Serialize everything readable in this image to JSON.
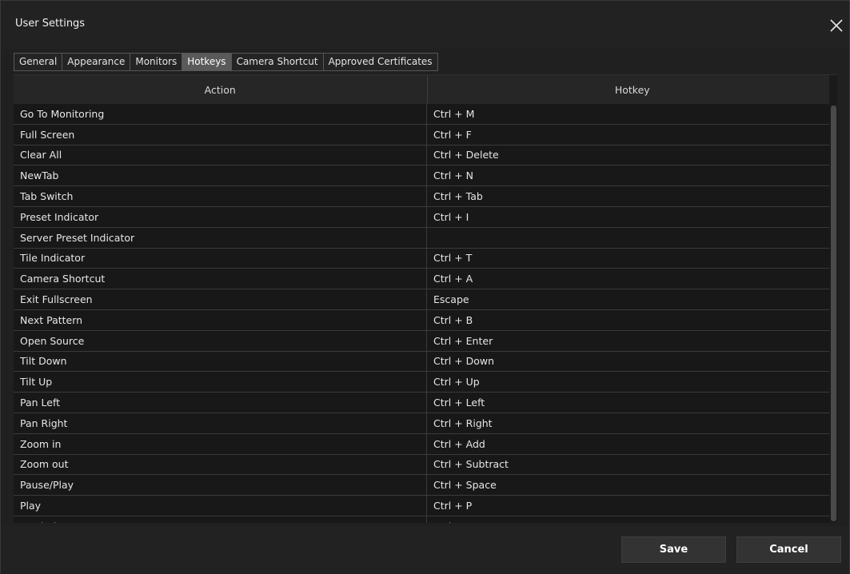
{
  "window": {
    "title": "User Settings",
    "close_icon": "close-icon"
  },
  "tabs": [
    {
      "label": "General",
      "active": false
    },
    {
      "label": "Appearance",
      "active": false
    },
    {
      "label": "Monitors",
      "active": false
    },
    {
      "label": "Hotkeys",
      "active": true
    },
    {
      "label": "Camera Shortcut",
      "active": false
    },
    {
      "label": "Approved Certificates",
      "active": false
    }
  ],
  "table": {
    "columns": [
      "Action",
      "Hotkey"
    ],
    "rows": [
      [
        "Go To Monitoring",
        "Ctrl + M"
      ],
      [
        "Full Screen",
        "Ctrl + F"
      ],
      [
        "Clear All",
        "Ctrl + Delete"
      ],
      [
        "NewTab",
        "Ctrl + N"
      ],
      [
        "Tab Switch",
        "Ctrl + Tab"
      ],
      [
        "Preset Indicator",
        "Ctrl + I"
      ],
      [
        "Server Preset Indicator",
        ""
      ],
      [
        "Tile Indicator",
        "Ctrl + T"
      ],
      [
        "Camera Shortcut",
        "Ctrl + A"
      ],
      [
        "Exit Fullscreen",
        "Escape"
      ],
      [
        "Next Pattern",
        "Ctrl + B"
      ],
      [
        "Open Source",
        "Ctrl + Enter"
      ],
      [
        "Tilt Down",
        "Ctrl + Down"
      ],
      [
        "Tilt Up",
        "Ctrl + Up"
      ],
      [
        "Pan Left",
        "Ctrl + Left"
      ],
      [
        "Pan Right",
        "Ctrl + Right"
      ],
      [
        "Zoom in",
        "Ctrl + Add"
      ],
      [
        "Zoom out",
        "Ctrl + Subtract"
      ],
      [
        "Pause/Play",
        "Ctrl + Space"
      ],
      [
        "Play",
        "Ctrl + P"
      ],
      [
        "Rewind",
        "Ctrl + R"
      ]
    ]
  },
  "footer": {
    "save_label": "Save",
    "cancel_label": "Cancel"
  },
  "colors": {
    "background": "#202020",
    "active_tab": "#5a5a5a",
    "button": "#333333"
  }
}
